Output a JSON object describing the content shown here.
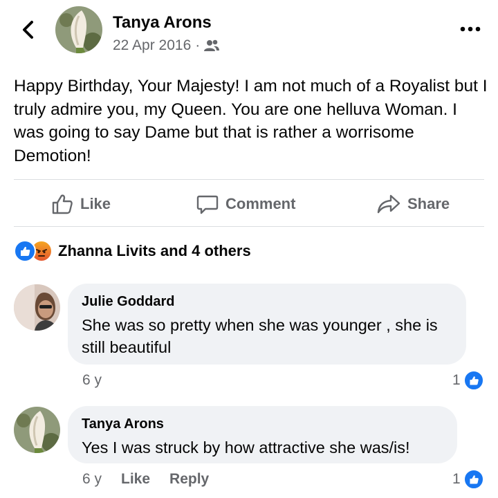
{
  "post": {
    "author": "Tanya Arons",
    "date": "22 Apr 2016",
    "separator": "·",
    "audience_icon": "friends-icon",
    "text": "Happy Birthday, Your Majesty!  I am not much of a Royalist but I truly admire you, my Queen.  You are one helluva Woman.  I was going to say Dame but that is rather a worrisome Demotion!"
  },
  "actions": {
    "like": "Like",
    "comment": "Comment",
    "share": "Share"
  },
  "reactions": {
    "summary": "Zhanna Livits and 4 others",
    "icons": [
      "like-reaction-icon",
      "angry-reaction-icon"
    ]
  },
  "comments": [
    {
      "name": "Julie Goddard",
      "text": "She was so pretty when she was younger , she is still beautiful",
      "time": "6 y",
      "likes": "1"
    },
    {
      "name": "Tanya Arons",
      "text": "Yes I was struck by how attractive she was/is!",
      "time": "6 y",
      "like_label": "Like",
      "reply_label": "Reply",
      "likes": "1"
    }
  ],
  "colors": {
    "text": "#050505",
    "secondary": "#65676b",
    "bubble": "#f0f2f5",
    "divider": "#dadde1",
    "brand_blue": "#1877f2"
  }
}
